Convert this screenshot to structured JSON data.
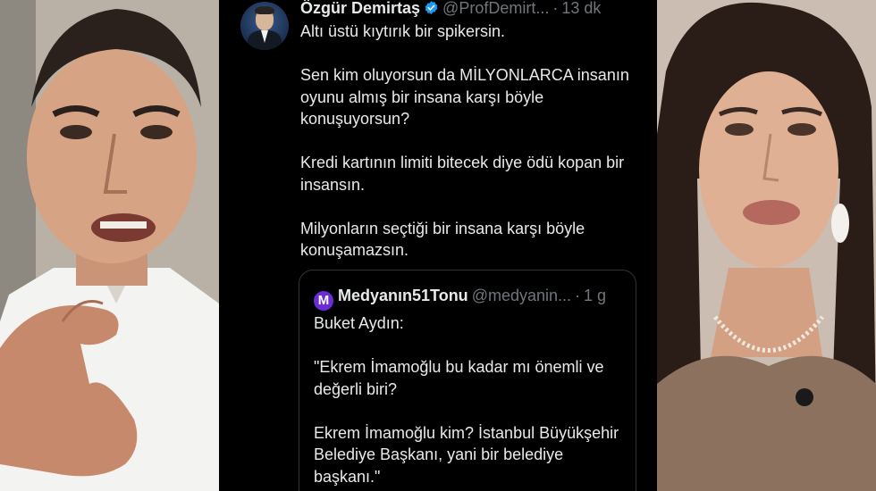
{
  "tweet": {
    "author_name": "Özgür Demirtaş",
    "verified_icon": "verified-badge-icon",
    "handle": "@ProfDemirt...",
    "separator": "·",
    "time": "13 dk",
    "paragraphs": [
      "Altı üstü kıytırık bir spikersin.",
      "Sen kim oluyorsun da MİLYONLARCA insanın oyunu almış bir insana karşı böyle konuşuyorsun?",
      "Kredi kartının limiti bitecek diye ödü kopan bir insansın.",
      "Milyonların seçtiği bir insana karşı böyle konuşamazsın."
    ]
  },
  "quote": {
    "logo_letter": "M",
    "author_name": "Medyanın51Tonu",
    "handle": "@medyanin...",
    "separator": "·",
    "time": "1 g",
    "paragraphs": [
      "Buket Aydın:",
      "\"Ekrem İmamoğlu bu kadar mı önemli ve değerli biri?",
      "Ekrem İmamoğlu kim? İstanbul Büyükşehir Belediye Başkanı, yani bir belediye başkanı.\""
    ]
  },
  "colors": {
    "background": "#000000",
    "text": "#e7e9ea",
    "muted": "#71767b",
    "verified_blue": "#1d9bf0",
    "quote_border": "#2f3336",
    "quote_logo": "#6b2bd9"
  }
}
